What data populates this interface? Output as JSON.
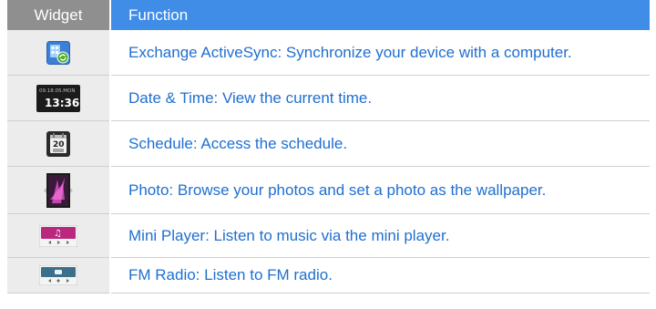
{
  "table": {
    "headers": {
      "widget": "Widget",
      "function": "Function"
    },
    "rows": [
      {
        "icon": "activesync-icon",
        "text": "Exchange ActiveSync: Synchronize your device with a computer."
      },
      {
        "icon": "clock-widget-icon",
        "icon_date": "09.18.05.MON",
        "icon_time": "13:36",
        "text": "Date & Time: View the current time."
      },
      {
        "icon": "calendar-icon",
        "icon_day": "20",
        "text": "Schedule: Access the schedule."
      },
      {
        "icon": "photo-frame-icon",
        "text": "Photo: Browse your photos and set a photo as the wallpaper."
      },
      {
        "icon": "mini-player-icon",
        "text": "Mini Player: Listen to music via the mini player."
      },
      {
        "icon": "fm-radio-icon",
        "text": "FM Radio: Listen to FM radio."
      }
    ]
  },
  "colors": {
    "header_widget_bg": "#8f8f8f",
    "header_function_bg": "#3f8de6",
    "row_text": "#1f6fd0",
    "icon_cell_bg": "#ececec"
  }
}
